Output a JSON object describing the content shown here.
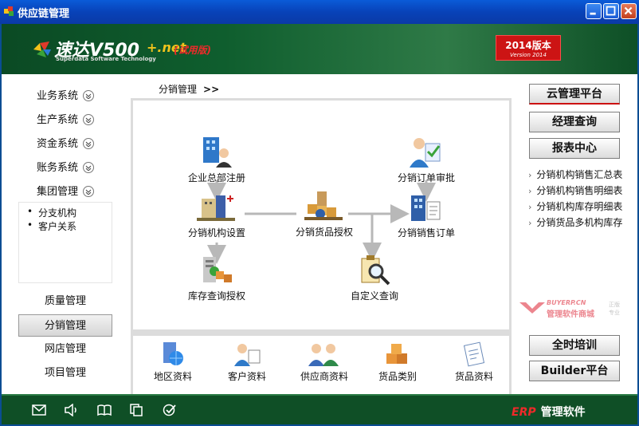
{
  "window": {
    "title": "供应链管理"
  },
  "header": {
    "logo_main": "速达V500",
    "logo_net": "+.net",
    "logo_trial": "(试用版)",
    "logo_sub": "Superdata Software Technology",
    "version_line1": "2014版本",
    "version_line2": "Version 2014"
  },
  "sidebar": {
    "collapsible": [
      {
        "label": "业务系统"
      },
      {
        "label": "生产系统"
      },
      {
        "label": "资金系统"
      },
      {
        "label": "账务系统"
      },
      {
        "label": "集团管理"
      }
    ],
    "sub_items": [
      "分支机构",
      "客户关系"
    ],
    "plain_items": [
      {
        "label": "质量管理"
      },
      {
        "label": "分销管理",
        "active": true
      },
      {
        "label": "网店管理"
      },
      {
        "label": "项目管理"
      }
    ]
  },
  "breadcrumb": {
    "label": "分销管理",
    "arrows": ">>"
  },
  "flow_nodes": {
    "hq_register": "企业总部注册",
    "org_setup": "分销机构设置",
    "goods_auth": "分销货品授权",
    "stock_query_auth": "库存查询授权",
    "order_approve": "分销订单审批",
    "sales_order": "分销销售订单",
    "custom_query": "自定义查询"
  },
  "bottom_links": [
    "地区资料",
    "客户资料",
    "供应商资料",
    "货品类别",
    "货品资料"
  ],
  "right_panel": {
    "cloud": "云管理平台",
    "manager_query": "经理查询",
    "report_center": "报表中心",
    "reports": [
      "分销机构销售汇总表",
      "分销机构销售明细表",
      "分销机构库存明细表",
      "分销货品多机构库存"
    ],
    "watermark_a": "BUYERP.CN",
    "watermark_b": "管理软件商城",
    "watermark_c": "正版",
    "watermark_d": "专业",
    "training": "全时培训",
    "builder": "Builder平台"
  },
  "footer": {
    "icons": [
      "mail-icon",
      "speaker-icon",
      "book-icon",
      "copy-icon",
      "check-icon"
    ],
    "erp": "ERP",
    "erp_suffix": "管理软件"
  },
  "colors": {
    "header_green": "#0f5e2e",
    "title_blue": "#0842b8",
    "version_red": "#cc1414",
    "accent_red": "#ee2a2a"
  }
}
